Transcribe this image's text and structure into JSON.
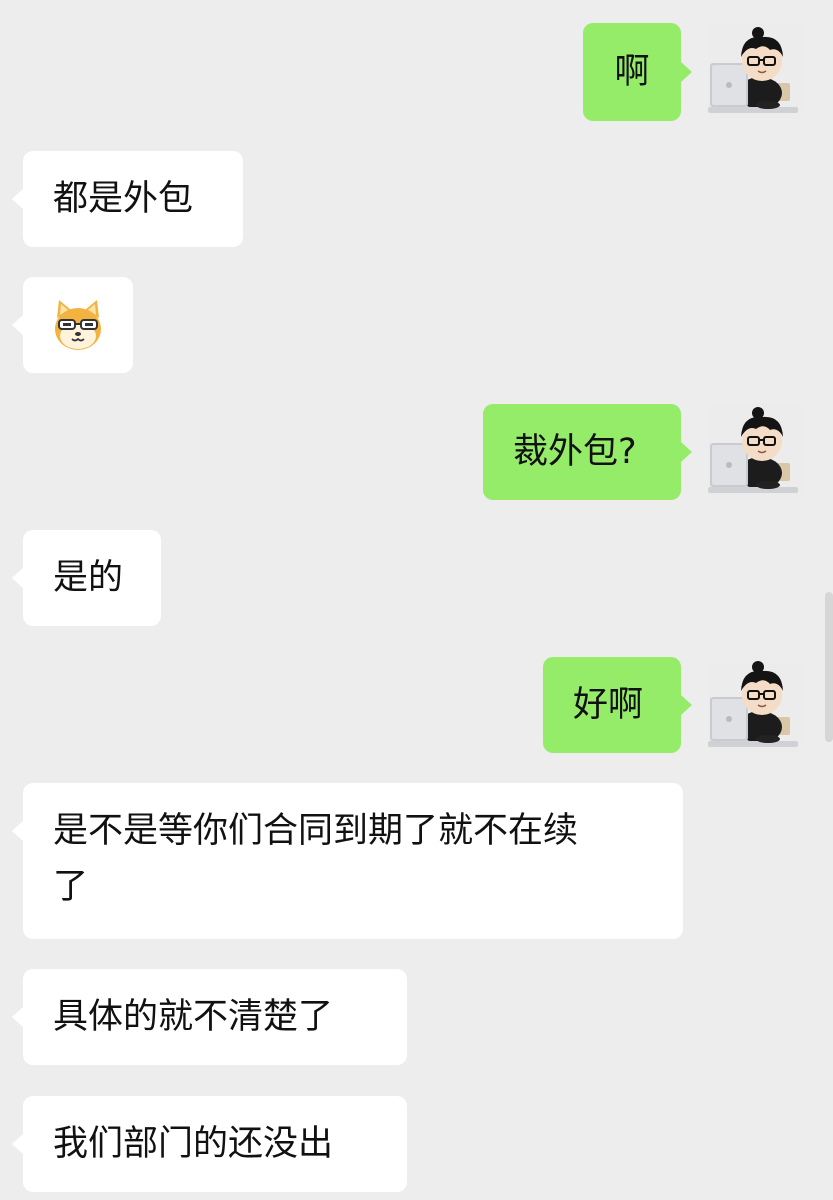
{
  "messages": [
    {
      "side": "out",
      "text": "啊"
    },
    {
      "side": "in",
      "text": "都是外包"
    },
    {
      "side": "in",
      "sticker": "dog-glasses-emoji"
    },
    {
      "side": "out",
      "text": "裁外包?"
    },
    {
      "side": "in",
      "text": "是的"
    },
    {
      "side": "out",
      "text": "好啊"
    },
    {
      "side": "in",
      "lines": [
        "是不是等你们合同到期了就不在续",
        "了"
      ]
    },
    {
      "side": "in",
      "text": "具体的就不清楚了"
    },
    {
      "side": "in",
      "text": "我们部门的还没出"
    }
  ],
  "colors": {
    "background": "#ededed",
    "incoming_bubble": "#ffffff",
    "outgoing_bubble": "#95ec69"
  },
  "icons": {
    "avatar": "cartoon-boy-laptop-avatar",
    "sticker": "dog-glasses-emoji"
  }
}
